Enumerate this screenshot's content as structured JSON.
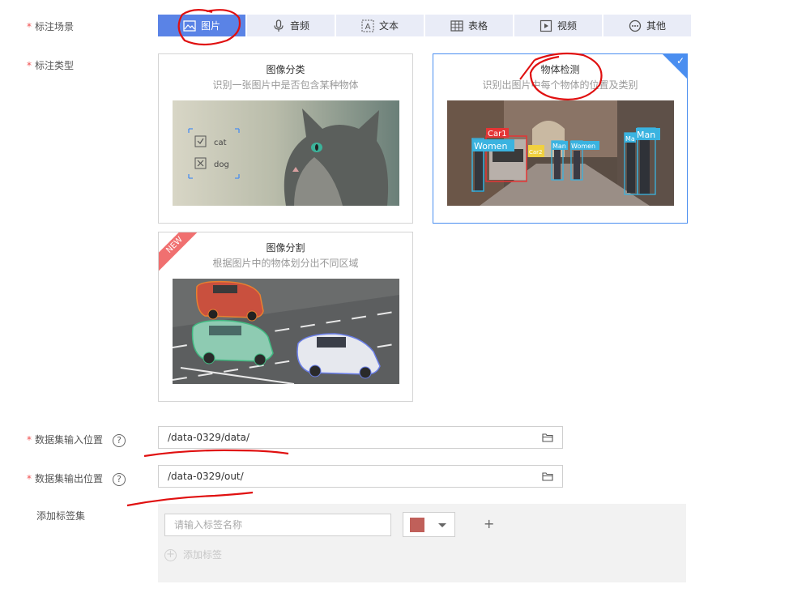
{
  "scene": {
    "label": "标注场景",
    "tabs": [
      {
        "label": "图片",
        "icon": "image-icon",
        "active": true
      },
      {
        "label": "音频",
        "icon": "microphone-icon",
        "active": false
      },
      {
        "label": "文本",
        "icon": "text-icon",
        "active": false
      },
      {
        "label": "表格",
        "icon": "table-icon",
        "active": false
      },
      {
        "label": "视频",
        "icon": "video-icon",
        "active": false
      },
      {
        "label": "其他",
        "icon": "more-icon",
        "active": false
      }
    ]
  },
  "type": {
    "label": "标注类型",
    "cards": [
      {
        "title": "图像分类",
        "desc": "识别一张图片中是否包含某种物体",
        "selected": false,
        "options": [
          "cat",
          "dog"
        ]
      },
      {
        "title": "物体检测",
        "desc": "识别出图片中每个物体的位置及类别",
        "selected": true,
        "boxes": [
          "Car1",
          "Women",
          "Car2",
          "Man",
          "Women",
          "Ma",
          "Man"
        ]
      },
      {
        "title": "图像分割",
        "desc": "根据图片中的物体划分出不同区域",
        "selected": false,
        "badge": "NEW"
      }
    ]
  },
  "dataset_input": {
    "label": "数据集输入位置",
    "value": "/data-0329/data/"
  },
  "dataset_output": {
    "label": "数据集输出位置",
    "value": "/data-0329/out/"
  },
  "label_set": {
    "label": "添加标签集",
    "placeholder": "请输入标签名称",
    "add_button": "+",
    "add_tag": "添加标签",
    "color": "#c0605a"
  },
  "colors": {
    "accent": "#5a83e6",
    "tab_bg": "#e9ecf7",
    "selected_border": "#4a8ef0",
    "required": "#f05050",
    "ink": "#e01010"
  }
}
